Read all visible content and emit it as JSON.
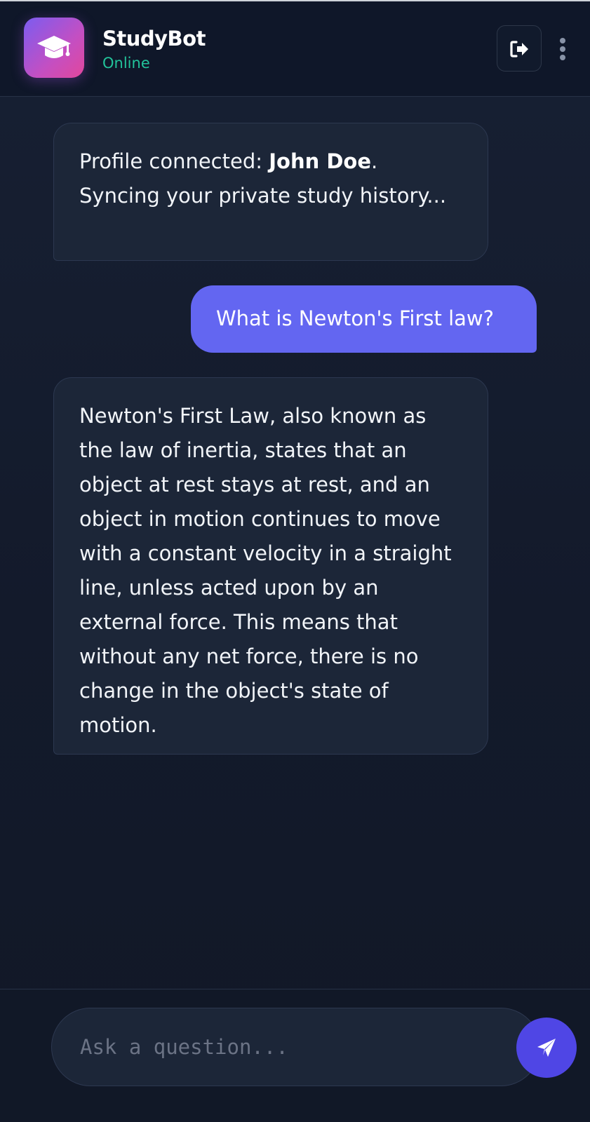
{
  "header": {
    "title": "StudyBot",
    "status": "Online",
    "logo_icon": "graduation-cap-icon",
    "logout_icon": "sign-out-icon",
    "menu_icon": "vertical-dots-icon"
  },
  "messages": [
    {
      "role": "bot",
      "prefix": "Profile connected: ",
      "name": "John Doe",
      "suffix": ". Syncing your private study history..."
    },
    {
      "role": "user",
      "text": "What is Newton's First law?"
    },
    {
      "role": "bot",
      "text": "Newton's First Law, also known as the law of inertia, states that an object at rest stays at rest, and an object in motion continues to move with a constant velocity in a straight line, unless acted upon by an external force. This means that without any net force, there is no change in the object's state of motion."
    }
  ],
  "composer": {
    "placeholder": "Ask a question...",
    "value": "",
    "send_icon": "paper-plane-icon"
  },
  "colors": {
    "accent": "#6366f1",
    "send_button": "#4f46e5",
    "status_online": "#22c39a",
    "background": "#131a2b"
  }
}
